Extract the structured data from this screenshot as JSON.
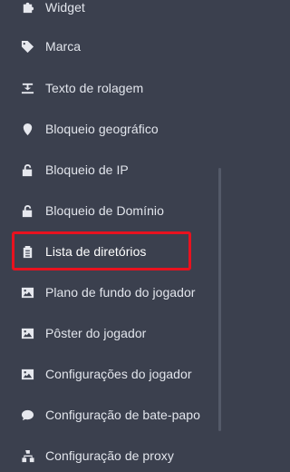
{
  "sidebar": {
    "items": [
      {
        "label": "Widget",
        "icon": "puzzle-icon"
      },
      {
        "label": "Marca",
        "icon": "tag-icon"
      },
      {
        "label": "Texto de rolagem",
        "icon": "text-scroll-icon"
      },
      {
        "label": "Bloqueio geográfico",
        "icon": "location-pin-icon"
      },
      {
        "label": "Bloqueio de IP",
        "icon": "unlock-icon"
      },
      {
        "label": "Bloqueio de Domínio",
        "icon": "unlock-icon"
      },
      {
        "label": "Lista de diretórios",
        "icon": "clipboard-icon",
        "active": true
      },
      {
        "label": "Plano de fundo do jogador",
        "icon": "image-icon"
      },
      {
        "label": "Pôster do jogador",
        "icon": "image-icon"
      },
      {
        "label": "Configurações do jogador",
        "icon": "image-icon"
      },
      {
        "label": "Configuração de bate-papo",
        "icon": "chat-bubble-icon"
      },
      {
        "label": "Configuração de proxy",
        "icon": "network-icon"
      }
    ]
  },
  "colors": {
    "background": "#3b404e",
    "text": "#e2e5ec",
    "highlight": "#e8121f"
  }
}
